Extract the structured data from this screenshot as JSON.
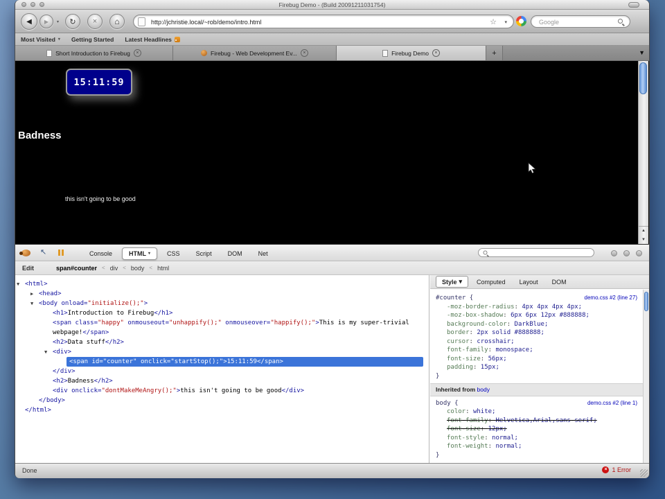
{
  "window": {
    "title": "Firebug Demo - (Build 20091211031754)"
  },
  "navbar": {
    "url": "http://jchristie.local/~rob/demo/intro.html",
    "search_placeholder": "Google"
  },
  "bookmarks": {
    "items": [
      {
        "label": "Most Visited",
        "dropdown": true
      },
      {
        "label": "Getting Started"
      },
      {
        "label": "Latest Headlines",
        "feed_icon": true
      }
    ]
  },
  "tabs": {
    "items": [
      {
        "label": "Short Introduction to Firebug",
        "icon": "page",
        "active": false
      },
      {
        "label": "Firebug - Web Development Ev...",
        "icon": "firebug",
        "active": false
      },
      {
        "label": "Firebug Demo",
        "icon": "page",
        "active": true
      }
    ],
    "new_tab_label": "+"
  },
  "page": {
    "clock": "15:11:59",
    "heading": "Badness",
    "message": "this isn't going to be good"
  },
  "firebug": {
    "tabs": [
      {
        "label": "Console"
      },
      {
        "label": "HTML",
        "active": true,
        "dropdown": true
      },
      {
        "label": "CSS"
      },
      {
        "label": "Script"
      },
      {
        "label": "DOM"
      },
      {
        "label": "Net"
      }
    ],
    "edit_label": "Edit",
    "breadcrumb": [
      "span#counter",
      "div",
      "body",
      "html"
    ],
    "tree": [
      {
        "indent": 0,
        "twisty": "open",
        "segments": [
          {
            "c": "tag",
            "s": "<html>"
          }
        ]
      },
      {
        "indent": 1,
        "twisty": "closed",
        "segments": [
          {
            "c": "tag",
            "s": "<head>"
          }
        ]
      },
      {
        "indent": 1,
        "twisty": "open",
        "segments": [
          {
            "c": "tag",
            "s": "<body"
          },
          {
            "c": "attr",
            "s": " onload="
          },
          {
            "c": "val",
            "s": "\"initialize();\""
          },
          {
            "c": "tag",
            "s": ">"
          }
        ]
      },
      {
        "indent": 2,
        "segments": [
          {
            "c": "tag",
            "s": "<h1>"
          },
          {
            "c": "text",
            "s": "Introduction to Firebug"
          },
          {
            "c": "tag",
            "s": "</h1>"
          }
        ]
      },
      {
        "indent": 2,
        "segments": [
          {
            "c": "tag",
            "s": "<span"
          },
          {
            "c": "attr",
            "s": " class="
          },
          {
            "c": "val",
            "s": "\"happy\""
          },
          {
            "c": "attr",
            "s": " onmouseout="
          },
          {
            "c": "val",
            "s": "\"unhappify();\""
          },
          {
            "c": "attr",
            "s": " onmouseover="
          },
          {
            "c": "val",
            "s": "\"happify();\""
          },
          {
            "c": "tag",
            "s": ">"
          },
          {
            "c": "text",
            "s": "This is my super-trivial webpage!"
          },
          {
            "c": "tag",
            "s": "</span>"
          }
        ]
      },
      {
        "indent": 2,
        "segments": [
          {
            "c": "tag",
            "s": "<h2>"
          },
          {
            "c": "text",
            "s": "Data stuff"
          },
          {
            "c": "tag",
            "s": "</h2>"
          }
        ]
      },
      {
        "indent": 2,
        "twisty": "open",
        "segments": [
          {
            "c": "tag",
            "s": "<div>"
          }
        ]
      },
      {
        "indent": 3,
        "selected": true,
        "segments": [
          {
            "c": "tag",
            "s": "<span"
          },
          {
            "c": "attr",
            "s": " id="
          },
          {
            "c": "val",
            "s": "\"counter\""
          },
          {
            "c": "attr",
            "s": " onclick="
          },
          {
            "c": "val",
            "s": "\"startStop();\""
          },
          {
            "c": "tag",
            "s": ">"
          },
          {
            "c": "text",
            "s": "15:11:59"
          },
          {
            "c": "tag",
            "s": "</span>"
          }
        ]
      },
      {
        "indent": 2,
        "segments": [
          {
            "c": "tag",
            "s": "</div>"
          }
        ]
      },
      {
        "indent": 2,
        "segments": [
          {
            "c": "tag",
            "s": "<h2>"
          },
          {
            "c": "text",
            "s": "Badness"
          },
          {
            "c": "tag",
            "s": "</h2>"
          }
        ]
      },
      {
        "indent": 2,
        "segments": [
          {
            "c": "tag",
            "s": "<div"
          },
          {
            "c": "attr",
            "s": " onclick="
          },
          {
            "c": "val",
            "s": "\"dontMakeMeAngry();\""
          },
          {
            "c": "tag",
            "s": ">"
          },
          {
            "c": "text",
            "s": "this isn't going to be good"
          },
          {
            "c": "tag",
            "s": "</div>"
          }
        ]
      },
      {
        "indent": 1,
        "segments": [
          {
            "c": "tag",
            "s": "</body>"
          }
        ]
      },
      {
        "indent": 0,
        "segments": [
          {
            "c": "tag",
            "s": "</html>"
          }
        ]
      }
    ],
    "style_panel": {
      "tabs": [
        {
          "label": "Style",
          "active": true,
          "dropdown": true
        },
        {
          "label": "Computed"
        },
        {
          "label": "Layout"
        },
        {
          "label": "DOM"
        }
      ],
      "sections": [
        {
          "type": "rule",
          "selector": "#counter",
          "source": "demo.css #2 (line 27)",
          "props": [
            {
              "name": "-moz-border-radius",
              "value": "4px 4px 4px 4px"
            },
            {
              "name": "-moz-box-shadow",
              "value": "6px 6px 12px #888888"
            },
            {
              "name": "background-color",
              "value": "DarkBlue"
            },
            {
              "name": "border",
              "value": "2px solid #888888"
            },
            {
              "name": "cursor",
              "value": "crosshair"
            },
            {
              "name": "font-family",
              "value": "monospace"
            },
            {
              "name": "font-size",
              "value": "56px"
            },
            {
              "name": "padding",
              "value": "15px"
            }
          ]
        },
        {
          "type": "header",
          "text": "Inherited from",
          "link": "body"
        },
        {
          "type": "rule",
          "selector": "body",
          "source": "demo.css #2 (line 1)",
          "props": [
            {
              "name": "color",
              "value": "white"
            },
            {
              "name": "font-family",
              "value": "Helvetica,Arial,sans-serif",
              "struck": true
            },
            {
              "name": "font-size",
              "value": "12px",
              "struck": true
            },
            {
              "name": "font-style",
              "value": "normal"
            },
            {
              "name": "font-weight",
              "value": "normal"
            }
          ]
        }
      ]
    }
  },
  "statusbar": {
    "left": "Done",
    "error": "1 Error"
  },
  "icons": {
    "back": "◀",
    "forward": "▶",
    "reload": "↻",
    "stop": "×",
    "home": "⌂",
    "bookmark_star": "☆",
    "caret_down": "▾",
    "all_tabs": "▼",
    "scroll_up": "▲",
    "scroll_down": "▼",
    "inspect": "↖",
    "twisty_open": "▼",
    "twisty_closed": "▶",
    "close": "×",
    "breadcrumb_sep": "<",
    "error_x": "×"
  },
  "colors": {
    "clock_bg": "#00008B",
    "selection": "#3B74D9",
    "error": "#CC1111",
    "link": "#0000C0"
  }
}
